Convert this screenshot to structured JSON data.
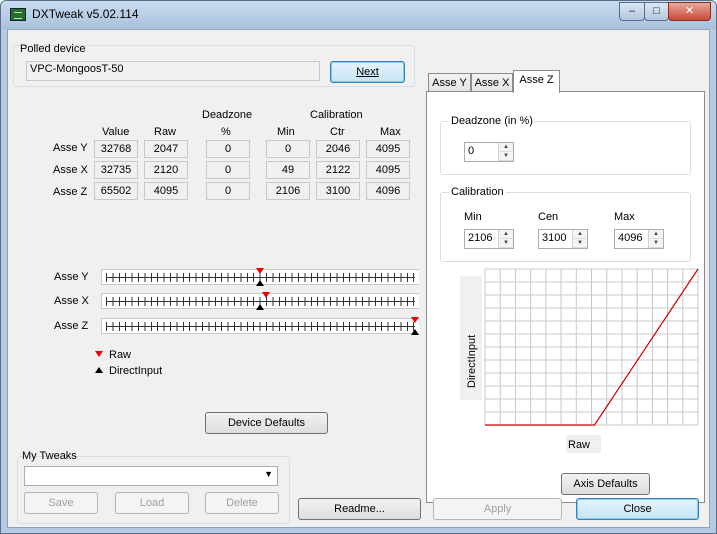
{
  "window": {
    "title": "DXTweak v5.02.114",
    "controls": {
      "minimize": "–",
      "maximize": "□",
      "close": "✕"
    }
  },
  "device": {
    "group_label": "Polled device",
    "value": "VPC-MongoosT-50",
    "next_label": "Next"
  },
  "table": {
    "header_deadzone": "Deadzone",
    "header_calibration": "Calibration",
    "cols": [
      "Value",
      "Raw",
      "%",
      "Min",
      "Ctr",
      "Max"
    ],
    "rows": [
      {
        "label": "Asse Y",
        "value": "32768",
        "raw": "2047",
        "deadzone": "0",
        "min": "0",
        "ctr": "2046",
        "max": "4095"
      },
      {
        "label": "Asse X",
        "value": "32735",
        "raw": "2120",
        "deadzone": "0",
        "min": "49",
        "ctr": "2122",
        "max": "4095"
      },
      {
        "label": "Asse Z",
        "value": "65502",
        "raw": "4095",
        "deadzone": "0",
        "min": "2106",
        "ctr": "3100",
        "max": "4096"
      }
    ]
  },
  "sliders": [
    {
      "label": "Asse Y",
      "raw_fraction": 0.5,
      "di_fraction": 0.5
    },
    {
      "label": "Asse X",
      "raw_fraction": 0.518,
      "di_fraction": 0.5
    },
    {
      "label": "Asse Z",
      "raw_fraction": 0.999,
      "di_fraction": 0.999
    }
  ],
  "legend": {
    "raw": "Raw",
    "directinput": "DirectInput",
    "raw_color": "#e00000",
    "di_color": "#000000"
  },
  "device_defaults_label": "Device Defaults",
  "tweaks": {
    "group_label": "My Tweaks",
    "value": "",
    "save": "Save",
    "load": "Load",
    "delete": "Delete"
  },
  "tabs": [
    "Asse Y",
    "Asse X",
    "Asse Z"
  ],
  "active_tab": "Asse Z",
  "axis_panel": {
    "deadzone_label": "Deadzone (in %)",
    "deadzone_value": "0",
    "calibration_label": "Calibration",
    "min_label": "Min",
    "cen_label": "Cen",
    "max_label": "Max",
    "min_value": "2106",
    "cen_value": "3100",
    "max_value": "4096",
    "ylabel": "DirectInput",
    "xlabel": "Raw",
    "axis_defaults_label": "Axis Defaults"
  },
  "chart_data": {
    "type": "line",
    "title": "",
    "xlabel": "Raw",
    "ylabel": "DirectInput",
    "x": [
      0,
      2106,
      4096
    ],
    "y": [
      0,
      0,
      65535
    ],
    "xlim": [
      0,
      4096
    ],
    "ylim": [
      0,
      65535
    ],
    "grid": true,
    "series": [
      {
        "values": [
          0,
          0,
          65535
        ],
        "color": "#cc0000"
      }
    ]
  },
  "buttons": {
    "readme": "Readme...",
    "apply": "Apply",
    "close": "Close"
  }
}
